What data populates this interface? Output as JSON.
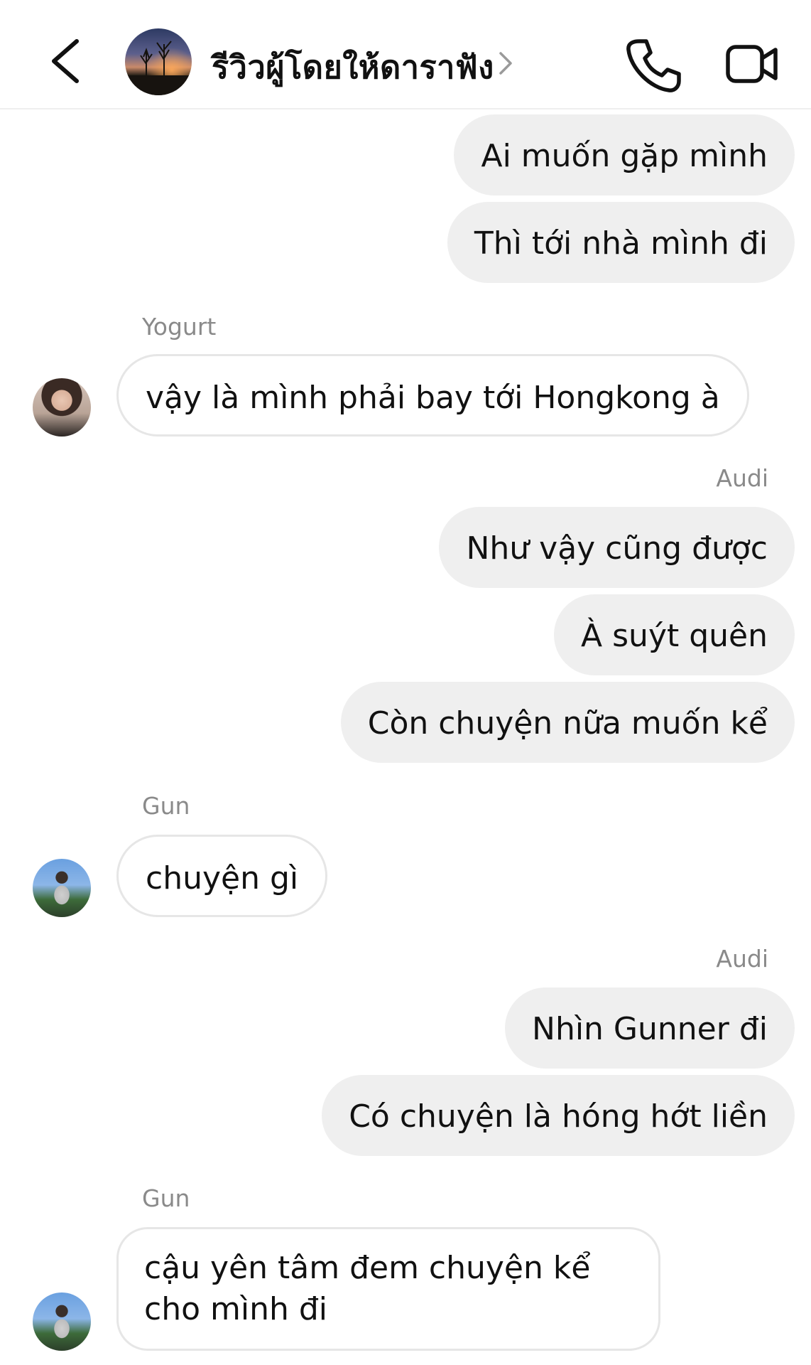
{
  "header": {
    "title": "รีวิวผู้โดยให้ดาราฟัง",
    "back_icon": "chevron-left-icon",
    "call_icon": "phone-icon",
    "video_icon": "video-camera-icon"
  },
  "messages": [
    {
      "text": "Ai muốn gặp mình"
    },
    {
      "text": "Thì tới nhà mình đi"
    },
    {
      "sender": "Yogurt"
    },
    {
      "text": "vậy là mình phải bay tới Hongkong à"
    },
    {
      "sender": "Audi"
    },
    {
      "text": "Như vậy cũng được"
    },
    {
      "text": "À suýt quên"
    },
    {
      "text": "Còn chuyện nữa muốn kể"
    },
    {
      "sender": "Gun"
    },
    {
      "text": "chuyện gì"
    },
    {
      "sender": "Audi"
    },
    {
      "text": "Nhìn Gunner đi"
    },
    {
      "text": "Có chuyện là hóng hớt liền"
    },
    {
      "sender": "Gun"
    },
    {
      "text": "cậu yên tâm đem chuyện kể cho mình đi"
    }
  ],
  "colors": {
    "outgoing_bubble": "#efefef",
    "incoming_border": "#e6e6e6",
    "sender_label": "#8a8a8a"
  }
}
